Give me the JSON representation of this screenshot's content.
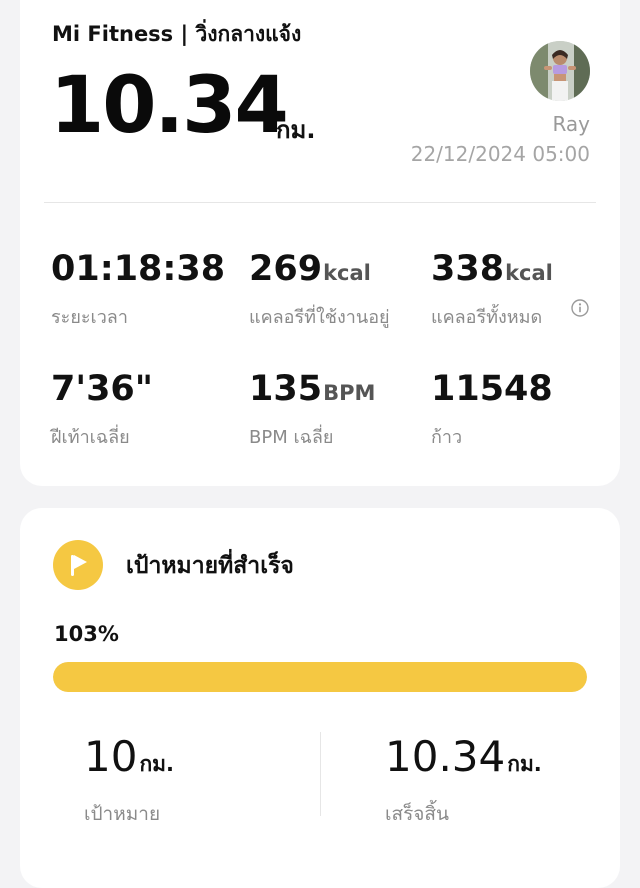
{
  "header": {
    "title": "Mi Fitness | วิ่งกลางแจ้ง",
    "distance_value": "10.34",
    "distance_unit": "กม.",
    "user_name": "Ray",
    "datetime": "22/12/2024 05:00"
  },
  "stats": [
    {
      "value": "01:18:38",
      "unit": "",
      "label": "ระยะเวลา"
    },
    {
      "value": "269",
      "unit": "kcal",
      "label": "แคลอรีที่ใช้งานอยู่"
    },
    {
      "value": "338",
      "unit": "kcal",
      "label": "แคลอรีทั้งหมด"
    },
    {
      "value": "7'36\"",
      "unit": "",
      "label": "ฝีเท้าเฉลี่ย"
    },
    {
      "value": "135",
      "unit": "BPM",
      "label": "BPM เฉลี่ย"
    },
    {
      "value": "11548",
      "unit": "",
      "label": "ก้าว"
    }
  ],
  "goal": {
    "title": "เป้าหมายที่สำเร็จ",
    "percent_label": "103%",
    "progress_fraction": 1.0,
    "target_value": "10",
    "target_unit": "กม.",
    "target_label": "เป้าหมาย",
    "completed_value": "10.34",
    "completed_unit": "กม.",
    "completed_label": "เสร็จสิ้น"
  },
  "icons": {
    "info": "info-icon",
    "goal": "flag-icon",
    "avatar": "avatar-photo"
  },
  "colors": {
    "accent": "#f5c842",
    "background": "#f3f3f5",
    "muted_text": "#8a8a8a"
  }
}
